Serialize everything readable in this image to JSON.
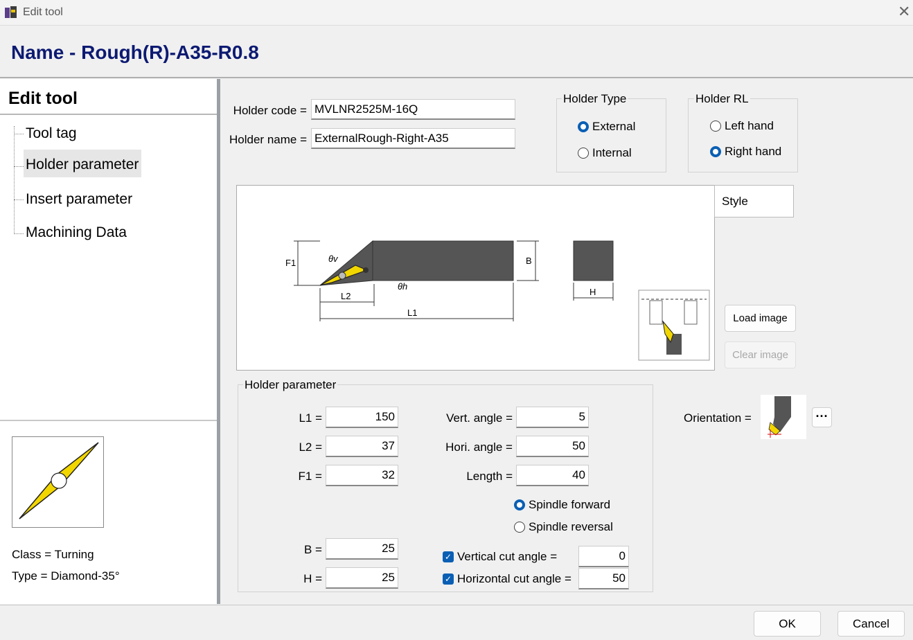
{
  "window": {
    "title": "Edit tool",
    "close_symbol": "✕"
  },
  "header": {
    "tool_name": "Name - Rough(R)-A35-R0.8"
  },
  "sidebar": {
    "title": "Edit tool",
    "items": [
      {
        "label": "Tool tag"
      },
      {
        "label": "Holder parameter"
      },
      {
        "label": "Insert parameter"
      },
      {
        "label": "Machining Data"
      }
    ],
    "class_line": "Class = Turning",
    "type_line": "Type = Diamond-35°"
  },
  "holder": {
    "code_label": "Holder code =",
    "code_value": "MVLNR2525M-16Q",
    "name_label": "Holder name =",
    "name_value": "ExternalRough-Right-A35"
  },
  "holder_type": {
    "title": "Holder Type",
    "options": [
      "External",
      "Internal"
    ],
    "selected": "External"
  },
  "holder_rl": {
    "title": "Holder RL",
    "options": [
      "Left hand",
      "Right hand"
    ],
    "selected": "Right hand"
  },
  "image": {
    "style_label": "Style",
    "load_label": "Load image",
    "clear_label": "Clear image",
    "diagram_labels": {
      "F1": "F1",
      "theta_v": "θv",
      "theta_h": "θh",
      "L2": "L2",
      "L1": "L1",
      "B": "B",
      "H": "H"
    }
  },
  "params": {
    "title": "Holder parameter",
    "L1": {
      "label": "L1 =",
      "value": "150"
    },
    "L2": {
      "label": "L2 =",
      "value": "37"
    },
    "F1": {
      "label": "F1 =",
      "value": "32"
    },
    "B": {
      "label": "B =",
      "value": "25"
    },
    "H": {
      "label": "H =",
      "value": "25"
    },
    "vert_angle": {
      "label": "Vert. angle =",
      "value": "5"
    },
    "hori_angle": {
      "label": "Hori. angle =",
      "value": "50"
    },
    "length": {
      "label": "Length =",
      "value": "40"
    },
    "spindle_options": [
      "Spindle forward",
      "Spindle reversal"
    ],
    "spindle_selected": "Spindle forward",
    "vertical_cut": {
      "label": "Vertical cut angle =",
      "value": "0",
      "checked": true
    },
    "horizontal_cut": {
      "label": "Horizontal cut angle =",
      "value": "50",
      "checked": true
    }
  },
  "orientation": {
    "label": "Orientation =",
    "more_label": "···"
  },
  "footer": {
    "ok_label": "OK",
    "cancel_label": "Cancel"
  },
  "colors": {
    "title_blue": "#0c1a72",
    "accent": "#0a5fb4",
    "insert_yellow": "#f2d600",
    "holder_gray": "#555555"
  }
}
